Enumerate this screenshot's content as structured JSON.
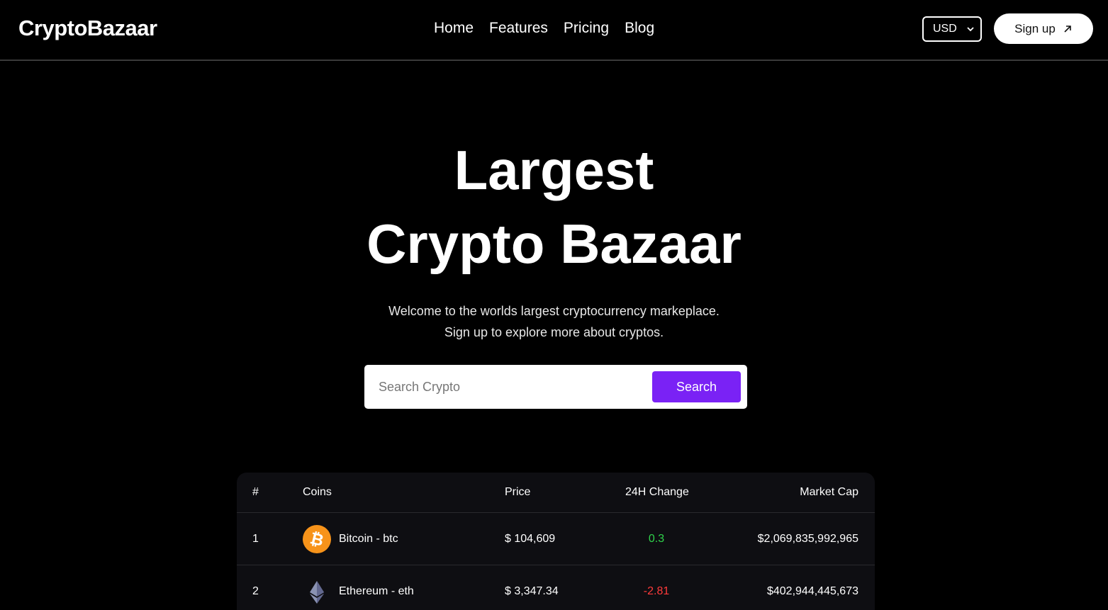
{
  "brand": "CryptoBazaar",
  "nav": {
    "links": [
      "Home",
      "Features",
      "Pricing",
      "Blog"
    ],
    "currency": "USD",
    "signup_label": "Sign up"
  },
  "hero": {
    "title_line1": "Largest",
    "title_line2": "Crypto Bazaar",
    "subtitle_line1": "Welcome to the worlds largest cryptocurrency markeplace.",
    "subtitle_line2": "Sign up to explore more about cryptos."
  },
  "search": {
    "placeholder": "Search Crypto",
    "button_label": "Search"
  },
  "table": {
    "headers": {
      "rank": "#",
      "coins": "Coins",
      "price": "Price",
      "change": "24H Change",
      "market_cap": "Market Cap"
    },
    "rows": [
      {
        "rank": "1",
        "coin": "Bitcoin - btc",
        "icon": "bitcoin-icon",
        "price": "$ 104,609",
        "change": "0.3",
        "change_color": "#2fd34b",
        "market_cap": "$2,069,835,992,965"
      },
      {
        "rank": "2",
        "coin": "Ethereum - eth",
        "icon": "ethereum-icon",
        "price": "$ 3,347.34",
        "change": "-2.81",
        "change_color": "#ff3b3b",
        "market_cap": "$402,944,445,673"
      }
    ]
  },
  "colors": {
    "accent": "#7a22f5",
    "background": "#000000",
    "table_bg": "#0e0e12",
    "positive": "#2fd34b",
    "negative": "#ff3b3b"
  }
}
